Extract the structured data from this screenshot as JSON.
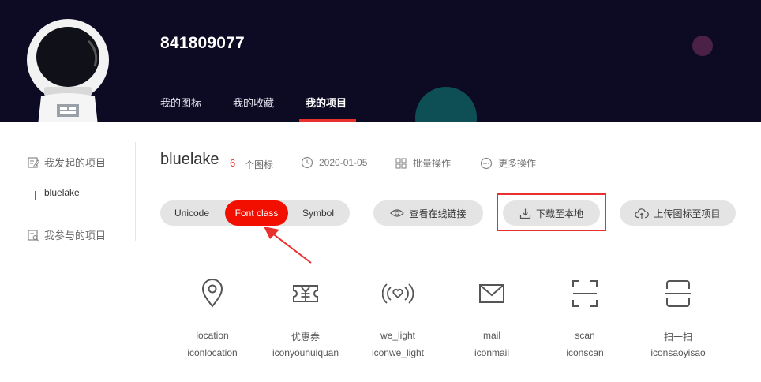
{
  "user": {
    "name": "841809077"
  },
  "tabs": [
    {
      "label": "我的图标"
    },
    {
      "label": "我的收藏"
    },
    {
      "label": "我的项目",
      "active": true
    }
  ],
  "sidebar": {
    "sections": [
      {
        "label": "我发起的项目",
        "icon": "edit-doc-icon"
      },
      {
        "label": "我参与的项目",
        "icon": "search-doc-icon"
      }
    ],
    "projects": [
      {
        "label": "bluelake",
        "active": true
      }
    ]
  },
  "project": {
    "name": "bluelake",
    "icon_count": "6",
    "icon_count_label": "个图标",
    "date": "2020-01-05",
    "batch_label": "批量操作",
    "more_label": "更多操作"
  },
  "toolbar": {
    "segments": [
      {
        "label": "Unicode"
      },
      {
        "label": "Font class",
        "active": true
      },
      {
        "label": "Symbol"
      }
    ],
    "view_online_label": "查看在线链接",
    "download_label": "下载至本地",
    "upload_label": "上传图标至项目"
  },
  "icons": [
    {
      "name": "location",
      "class": "iconlocation",
      "icon": "location-pin-icon"
    },
    {
      "name": "优惠券",
      "class": "iconyouhuiquan",
      "icon": "coupon-icon"
    },
    {
      "name": "we_light",
      "class": "iconwe_light",
      "icon": "wireless-heart-icon"
    },
    {
      "name": "mail",
      "class": "iconmail",
      "icon": "mail-icon"
    },
    {
      "name": "scan",
      "class": "iconscan",
      "icon": "scan-icon"
    },
    {
      "name": "扫一扫",
      "class": "iconsaoyisao",
      "icon": "scan-line-icon"
    }
  ],
  "colors": {
    "header_bg": "#0d0a24",
    "accent": "#f30f00",
    "annotation": "#e8302e"
  }
}
